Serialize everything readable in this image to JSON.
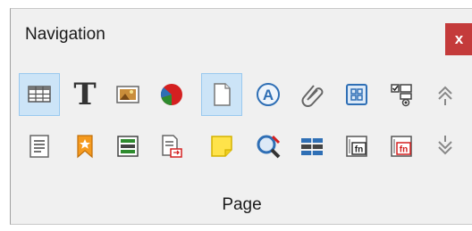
{
  "window": {
    "title": "Navigation",
    "close_label": "x"
  },
  "footer": {
    "label": "Page"
  },
  "toolbar_icons": [
    "tables-icon",
    "text-frames-icon",
    "images-icon",
    "ole-objects-icon",
    "pages-icon",
    "styles-icon",
    "links-icon",
    "frames-icon",
    "form-controls-icon",
    "previous-up-icon",
    "paragraph-icon",
    "bookmarks-icon",
    "sections-icon",
    "headings-icon",
    "comments-icon",
    "indexes-icon",
    "fields-icon",
    "footnotes-icon",
    "endnotes-icon",
    "next-down-icon"
  ],
  "colors": {
    "close_bg": "#c43b3b",
    "selection_bg": "#cce4f7",
    "selection_border": "#99c9ef",
    "icon_blue": "#2f6fb5",
    "icon_orange": "#f59a1e",
    "icon_red": "#d42020",
    "icon_green": "#2e8b2e"
  }
}
